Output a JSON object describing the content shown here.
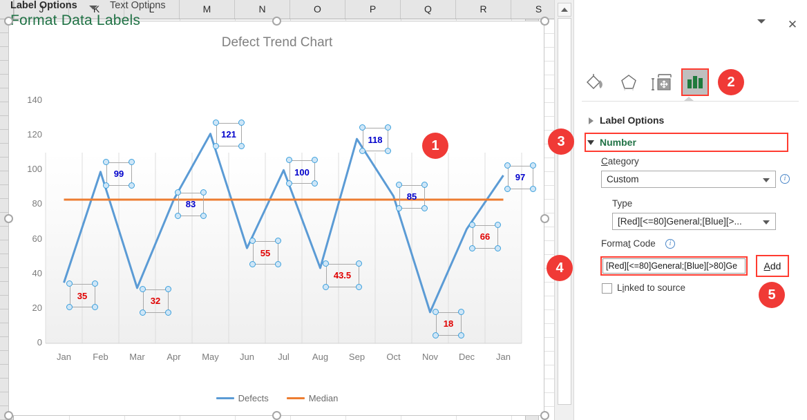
{
  "spreadsheet": {
    "column_headers": [
      "J",
      "K",
      "L",
      "M",
      "N",
      "O",
      "P",
      "Q",
      "R",
      "S"
    ]
  },
  "scrollbar": {
    "up_arrow": "scroll-up-arrow"
  },
  "chart": {
    "title": "Defect Trend Chart",
    "legend": [
      {
        "name": "Defects",
        "color": "#5B9BD5"
      },
      {
        "name": "Median",
        "color": "#ED7D31"
      }
    ]
  },
  "chart_data": {
    "type": "line",
    "title": "Defect Trend Chart",
    "xlabel": "",
    "ylabel": "",
    "ylim": [
      0,
      150
    ],
    "yticks": [
      0,
      20,
      40,
      60,
      80,
      100,
      120,
      140
    ],
    "categories": [
      "Jan",
      "Feb",
      "Mar",
      "Apr",
      "May",
      "Jun",
      "Jul",
      "Aug",
      "Sep",
      "Oct",
      "Nov",
      "Dec",
      "Jan"
    ],
    "grid": "vertical",
    "legend_position": "bottom",
    "series": [
      {
        "name": "Defects",
        "color": "#5B9BD5",
        "values": [
          35,
          99,
          32,
          83,
          121,
          55,
          100,
          43.5,
          118,
          85,
          18,
          66,
          97
        ],
        "labels": [
          "35",
          "99",
          "32",
          "83",
          "121",
          "55",
          "100",
          "43.5",
          "118",
          "85",
          "18",
          "66",
          "97"
        ],
        "label_colors": [
          "#e00000",
          "#0000cc",
          "#e00000",
          "#0000cc",
          "#0000cc",
          "#e00000",
          "#0000cc",
          "#e00000",
          "#0000cc",
          "#0000cc",
          "#e00000",
          "#e00000",
          "#0000cc"
        ]
      },
      {
        "name": "Median",
        "color": "#ED7D31",
        "values": [
          83,
          83,
          83,
          83,
          83,
          83,
          83,
          83,
          83,
          83,
          83,
          83,
          83
        ]
      }
    ]
  },
  "pane": {
    "title": "Format Data Labels",
    "menu_arrow_icon": "chevron-down-icon",
    "close_icon": "✕",
    "tabs": {
      "label_options": "Label Options",
      "text_options": "Text Options"
    },
    "icons": [
      {
        "name": "fill-and-line-icon",
        "label": "Fill & Line"
      },
      {
        "name": "effects-icon",
        "label": "Effects"
      },
      {
        "name": "size-and-properties-icon",
        "label": "Size & Properties"
      },
      {
        "name": "label-options-icon",
        "label": "Label Options"
      }
    ],
    "sections": {
      "label_options": "Label Options",
      "number": "Number"
    },
    "fields": {
      "category_label": "Category",
      "category_label_accel": "C",
      "category_value": "Custom",
      "type_label": "Type",
      "type_value": "[Red][<=80]General;[Blue][>...",
      "format_code_label": "Format Code",
      "format_code_accel": "t",
      "format_code_value": "[Red][<=80]General;[Blue][>80]Ge",
      "add_button": "Add",
      "add_button_accel": "A",
      "linked_to_source": "Linked to source",
      "linked_to_source_accel": "i",
      "linked_to_source_checked": false
    },
    "accent_green": "#217346",
    "highlight_red": "#ff3b30"
  },
  "badges": [
    {
      "id": "1",
      "label": "1"
    },
    {
      "id": "2",
      "label": "2"
    },
    {
      "id": "3",
      "label": "3"
    },
    {
      "id": "4",
      "label": "4"
    },
    {
      "id": "5",
      "label": "5"
    }
  ]
}
